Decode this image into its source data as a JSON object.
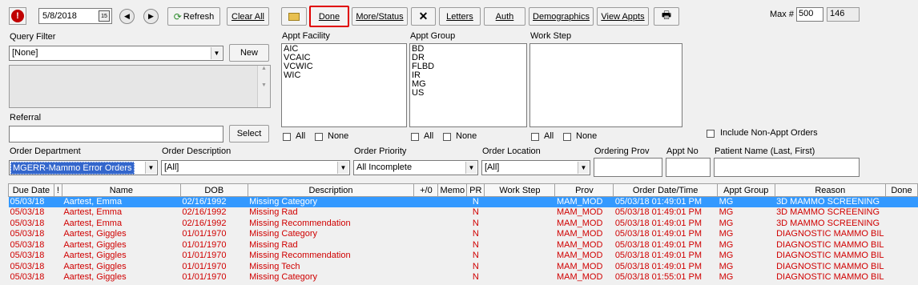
{
  "toolbar": {
    "date_value": "5/8/2018",
    "refresh_label": "Refresh",
    "clear_all_label": "Clear All",
    "done_label": "Done",
    "more_status_label": "More/Status",
    "close_glyph": "✕",
    "letters_label": "Letters",
    "auth_label": "Auth",
    "demographics_label": "Demographics",
    "view_appts_label": "View Appts",
    "max_label": "Max #",
    "max_value": "500",
    "count_value": "146"
  },
  "query": {
    "label": "Query Filter",
    "selected": "[None]",
    "new_label": "New",
    "referral_label": "Referral",
    "select_label": "Select"
  },
  "facility": {
    "label": "Appt Facility",
    "items": [
      "AIC",
      "VCAIC",
      "VCWIC",
      "WIC"
    ]
  },
  "group": {
    "label": "Appt Group",
    "items": [
      "BD",
      "DR",
      "FLBD",
      "IR",
      "MG",
      "US"
    ]
  },
  "workstep": {
    "label": "Work Step",
    "items": []
  },
  "checks": {
    "all_label": "All",
    "none_label": "None",
    "include_non_appt_label": "Include Non-Appt Orders"
  },
  "filters": {
    "dept_label": "Order Department",
    "dept_value": "MGERR-Mammo Error Orders",
    "desc_label": "Order Description",
    "desc_value": "[All]",
    "priority_label": "Order Priority",
    "priority_value": "All Incomplete",
    "location_label": "Order Location",
    "location_value": "[All]",
    "prov_label": "Ordering Prov",
    "appt_no_label": "Appt No",
    "patient_label": "Patient Name (Last, First)"
  },
  "grid": {
    "columns": [
      "Due Date",
      "!",
      "Name",
      "DOB",
      "Description",
      "+/0",
      "Memo",
      "PR",
      "Work Step",
      "Prov",
      "Order Date/Time",
      "Appt Group",
      "Reason",
      "Done"
    ],
    "rows": [
      [
        "05/03/18",
        "",
        "Aartest, Emma",
        "02/16/1992",
        "Missing Category",
        "",
        "",
        "N",
        "",
        "MAM_MOD",
        "05/03/18 01:49:01 PM",
        "MG",
        "3D MAMMO SCREENING",
        ""
      ],
      [
        "05/03/18",
        "",
        "Aartest, Emma",
        "02/16/1992",
        "Missing Rad",
        "",
        "",
        "N",
        "",
        "MAM_MOD",
        "05/03/18 01:49:01 PM",
        "MG",
        "3D MAMMO SCREENING",
        ""
      ],
      [
        "05/03/18",
        "",
        "Aartest, Emma",
        "02/16/1992",
        "Missing Recommendation",
        "",
        "",
        "N",
        "",
        "MAM_MOD",
        "05/03/18 01:49:01 PM",
        "MG",
        "3D MAMMO SCREENING",
        ""
      ],
      [
        "05/03/18",
        "",
        "Aartest, Giggles",
        "01/01/1970",
        "Missing Category",
        "",
        "",
        "N",
        "",
        "MAM_MOD",
        "05/03/18 01:49:01 PM",
        "MG",
        "DIAGNOSTIC MAMMO BIL",
        ""
      ],
      [
        "05/03/18",
        "",
        "Aartest, Giggles",
        "01/01/1970",
        "Missing Rad",
        "",
        "",
        "N",
        "",
        "MAM_MOD",
        "05/03/18 01:49:01 PM",
        "MG",
        "DIAGNOSTIC MAMMO BIL",
        ""
      ],
      [
        "05/03/18",
        "",
        "Aartest, Giggles",
        "01/01/1970",
        "Missing Recommendation",
        "",
        "",
        "N",
        "",
        "MAM_MOD",
        "05/03/18 01:49:01 PM",
        "MG",
        "DIAGNOSTIC MAMMO BIL",
        ""
      ],
      [
        "05/03/18",
        "",
        "Aartest, Giggles",
        "01/01/1970",
        "Missing Tech",
        "",
        "",
        "N",
        "",
        "MAM_MOD",
        "05/03/18 01:49:01 PM",
        "MG",
        "DIAGNOSTIC MAMMO BIL",
        ""
      ],
      [
        "05/03/18",
        "",
        "Aartest, Giggles",
        "01/01/1970",
        "Missing Category",
        "",
        "",
        "N",
        "",
        "MAM_MOD",
        "05/03/18 01:55:01 PM",
        "MG",
        "DIAGNOSTIC MAMMO BIL",
        ""
      ]
    ]
  },
  "colors": {
    "row_text": "#d00000",
    "selection": "#3399ff",
    "done_highlight": "#e00000",
    "dept_select_bg": "#3366cc"
  }
}
